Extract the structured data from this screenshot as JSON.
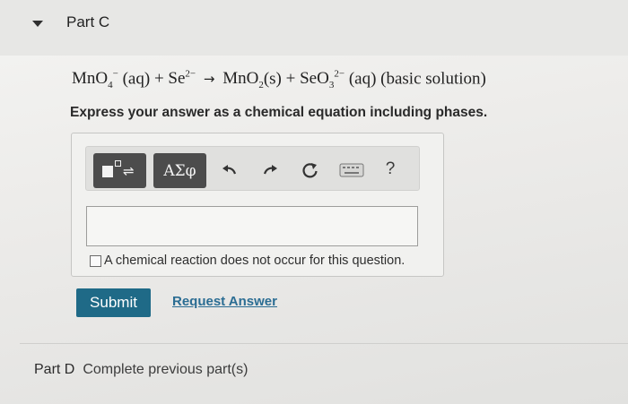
{
  "part_c": {
    "title": "Part C",
    "equation": {
      "reactant1": "MnO",
      "reactant1_sub": "4",
      "reactant1_sup": "−",
      "reactant1_phase": "(aq)",
      "plus1": "+",
      "reactant2": "Se",
      "reactant2_sup": "2−",
      "arrow": "→",
      "product1": "MnO",
      "product1_sub": "2",
      "product1_phase": "(s)",
      "plus2": "+",
      "product2": "SeO",
      "product2_sub": "3",
      "product2_sup": "2−",
      "product2_phase": "(aq)",
      "condition": "(basic solution)"
    },
    "instruction": "Express your answer as a chemical equation including phases.",
    "toolbar": {
      "symbols_label": "ΑΣφ",
      "help_label": "?",
      "icons": [
        "templates-icon",
        "undo-icon",
        "redo-icon",
        "reset-icon",
        "keyboard-icon",
        "help-icon"
      ]
    },
    "answer_value": "",
    "no_reaction_label": "A chemical reaction does not occur for this question.",
    "no_reaction_checked": false,
    "submit_label": "Submit",
    "request_answer_label": "Request Answer"
  },
  "part_d": {
    "label": "Part D",
    "status": "Complete previous part(s)"
  },
  "colors": {
    "submit_bg": "#1f6a87",
    "link": "#2b6d93",
    "tool_button_bg": "#4c4c4c"
  }
}
